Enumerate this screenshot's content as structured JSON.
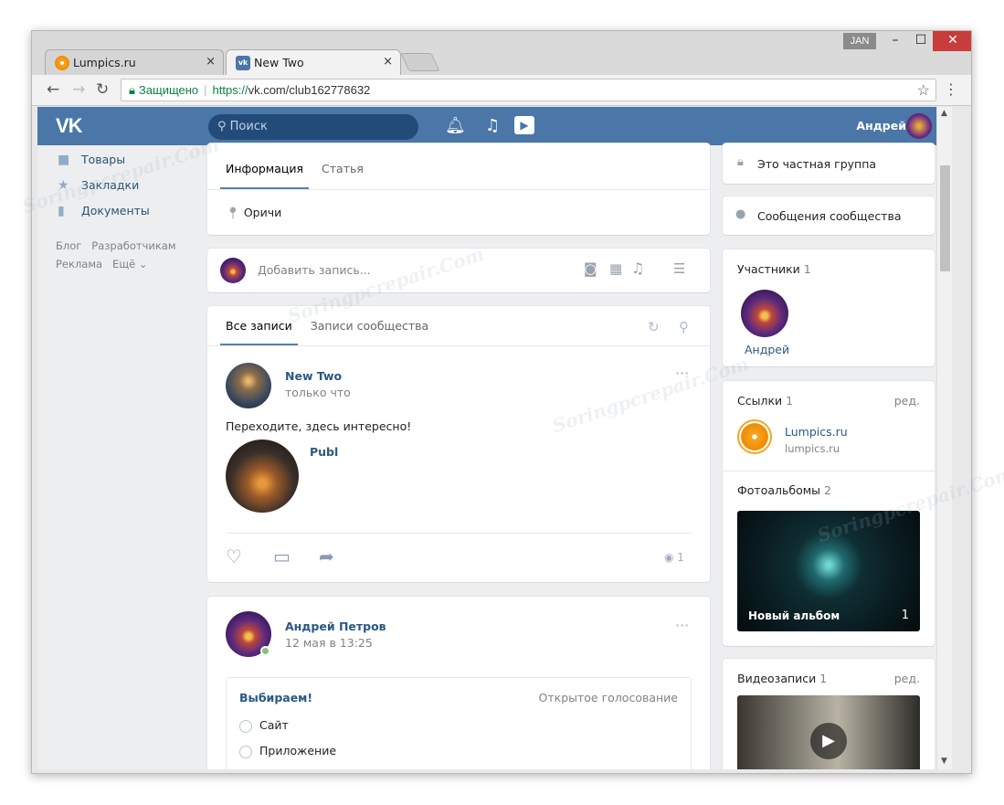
{
  "browser": {
    "tabs": [
      {
        "label": "Lumpics.ru",
        "close": "×"
      },
      {
        "label": "New Two",
        "close": "×"
      }
    ],
    "user_badge": "JAN",
    "window_controls": {
      "minimize": "–",
      "maximize": "☐",
      "close": "✕"
    },
    "nav": {
      "back": "←",
      "forward": "→",
      "reload": "↻"
    },
    "security_label": "Защищено",
    "url_scheme": "https://",
    "url_host": "vk.com",
    "url_path": "/club162778632",
    "bookmark": "☆",
    "menu": "⋮"
  },
  "vk": {
    "logo": "VK",
    "search_placeholder": "Поиск",
    "header_icons": [
      "bell-icon",
      "music-icon",
      "video-icon"
    ],
    "user_name": "Андрей",
    "left_nav": [
      {
        "label": "Товары",
        "icon": "bag-icon"
      },
      {
        "label": "Закладки",
        "icon": "star-icon"
      },
      {
        "label": "Документы",
        "icon": "document-icon"
      }
    ],
    "footer_links": {
      "blog": "Блог",
      "devs": "Разработчикам",
      "ads": "Реклама",
      "more": "Ещё ⌄"
    },
    "info_tabs": [
      "Информация",
      "Статья"
    ],
    "location": "Оричи",
    "add_post_placeholder": "Добавить запись...",
    "wall_tabs": [
      "Все записи",
      "Записи сообщества"
    ],
    "post1": {
      "author": "New Two",
      "time": "только что",
      "text": "Переходите, здесь интересно!",
      "link_title": "Publ",
      "views": "1"
    },
    "post2": {
      "author": "Андрей Петров",
      "time": "12 мая в 13:25",
      "poll": {
        "title": "Выбираем!",
        "type": "Открытое голосование",
        "options": [
          "Сайт",
          "Приложение"
        ]
      }
    },
    "right": {
      "private_group": "Это частная группа",
      "messages": "Сообщения сообщества",
      "members_title": "Участники",
      "members_count": "1",
      "member_name": "Андрей",
      "links_title": "Ссылки",
      "links_count": "1",
      "edit": "ред.",
      "link_name": "Lumpics.ru",
      "link_url": "lumpics.ru",
      "albums_title": "Фотоальбомы",
      "albums_count": "2",
      "album_name": "Новый альбом",
      "album_count": "1",
      "videos_title": "Видеозаписи",
      "videos_count": "1"
    }
  },
  "watermark": "Soringpcrepair.Com",
  "colors": {
    "vk_blue": "#4a76a8",
    "link": "#2a5885",
    "secure_green": "#0b8043"
  }
}
